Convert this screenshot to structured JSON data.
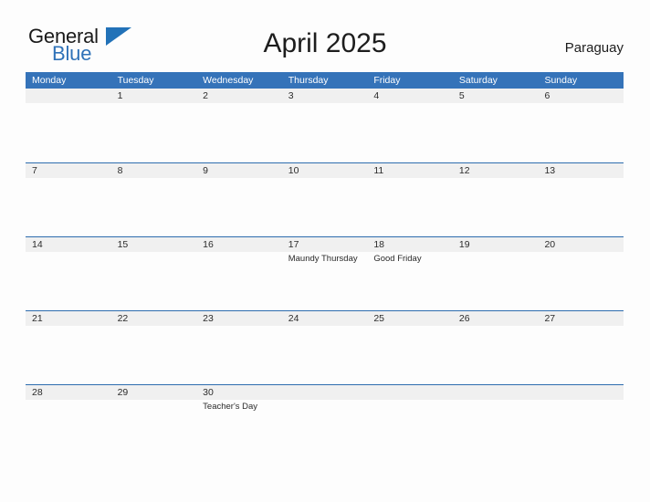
{
  "brand": {
    "name_top": "General",
    "name_bottom": "Blue",
    "triangle_color": "#2272b8",
    "text_color": "#1a1a1a",
    "accent_color": "#2f72b8"
  },
  "header": {
    "title": "April 2025",
    "locale": "Paraguay"
  },
  "theme": {
    "header_blue": "#3573b9",
    "row_divider_blue": "#2d6cae",
    "band_gray": "#f0f0f0",
    "page_background": "#fdfdfd",
    "text_color": "#2b2b2b"
  },
  "calendar": {
    "month": "April",
    "year": "2025",
    "weekday_headers": [
      "Monday",
      "Tuesday",
      "Wednesday",
      "Thursday",
      "Friday",
      "Saturday",
      "Sunday"
    ],
    "weeks": [
      {
        "days": [
          {
            "date": "",
            "events": []
          },
          {
            "date": "1",
            "events": []
          },
          {
            "date": "2",
            "events": []
          },
          {
            "date": "3",
            "events": []
          },
          {
            "date": "4",
            "events": []
          },
          {
            "date": "5",
            "events": []
          },
          {
            "date": "6",
            "events": []
          }
        ]
      },
      {
        "days": [
          {
            "date": "7",
            "events": []
          },
          {
            "date": "8",
            "events": []
          },
          {
            "date": "9",
            "events": []
          },
          {
            "date": "10",
            "events": []
          },
          {
            "date": "11",
            "events": []
          },
          {
            "date": "12",
            "events": []
          },
          {
            "date": "13",
            "events": []
          }
        ]
      },
      {
        "days": [
          {
            "date": "14",
            "events": []
          },
          {
            "date": "15",
            "events": []
          },
          {
            "date": "16",
            "events": []
          },
          {
            "date": "17",
            "events": [
              "Maundy Thursday"
            ]
          },
          {
            "date": "18",
            "events": [
              "Good Friday"
            ]
          },
          {
            "date": "19",
            "events": []
          },
          {
            "date": "20",
            "events": []
          }
        ]
      },
      {
        "days": [
          {
            "date": "21",
            "events": []
          },
          {
            "date": "22",
            "events": []
          },
          {
            "date": "23",
            "events": []
          },
          {
            "date": "24",
            "events": []
          },
          {
            "date": "25",
            "events": []
          },
          {
            "date": "26",
            "events": []
          },
          {
            "date": "27",
            "events": []
          }
        ]
      },
      {
        "days": [
          {
            "date": "28",
            "events": []
          },
          {
            "date": "29",
            "events": []
          },
          {
            "date": "30",
            "events": [
              "Teacher's Day"
            ]
          },
          {
            "date": "",
            "events": []
          },
          {
            "date": "",
            "events": []
          },
          {
            "date": "",
            "events": []
          },
          {
            "date": "",
            "events": []
          }
        ]
      }
    ]
  }
}
